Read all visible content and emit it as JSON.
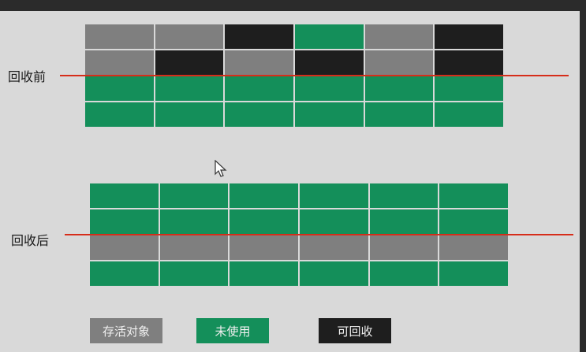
{
  "labels": {
    "before": "回收前",
    "after": "回收后"
  },
  "legend": {
    "alive": "存活对象",
    "unused": "未使用",
    "reclaimable": "可回收"
  },
  "colors": {
    "alive": "#7f7f7f",
    "unused": "#148f5a",
    "reclaimable": "#1e1e1e",
    "divider": "#d62d1a"
  },
  "grids": {
    "before": [
      [
        "alive",
        "alive",
        "reclaimable",
        "unused",
        "alive",
        "reclaimable"
      ],
      [
        "alive",
        "reclaimable",
        "alive",
        "reclaimable",
        "alive",
        "reclaimable"
      ],
      [
        "unused",
        "unused",
        "unused",
        "unused",
        "unused",
        "unused"
      ],
      [
        "unused",
        "unused",
        "unused",
        "unused",
        "unused",
        "unused"
      ]
    ],
    "after": [
      [
        "unused",
        "unused",
        "unused",
        "unused",
        "unused",
        "unused"
      ],
      [
        "unused",
        "unused",
        "unused",
        "unused",
        "unused",
        "unused"
      ],
      [
        "alive",
        "alive",
        "alive",
        "alive",
        "alive",
        "alive"
      ],
      [
        "unused",
        "unused",
        "unused",
        "unused",
        "unused",
        "unused"
      ]
    ]
  },
  "icons": {
    "cursor": "mouse-pointer-icon"
  }
}
